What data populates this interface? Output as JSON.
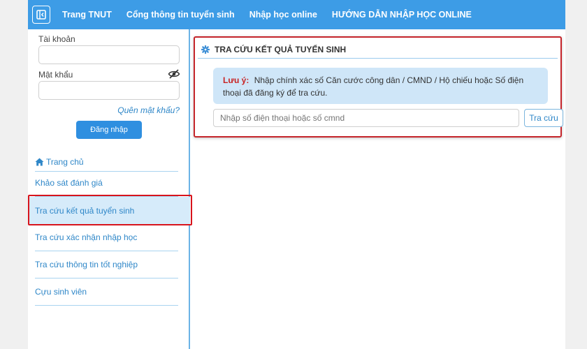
{
  "navbar": {
    "toggle_icon": "sidebar-collapse-icon",
    "links": [
      "Trang TNUT",
      "Cổng thông tin tuyển sinh",
      "Nhập học online",
      "HƯỚNG DẪN NHẬP HỌC ONLINE"
    ]
  },
  "login": {
    "account_label": "Tài khoản",
    "account_value": "",
    "password_label": "Mật khẩu",
    "password_value": "",
    "forgot_label": "Quên mật khẩu?",
    "login_button": "Đăng nhập"
  },
  "sidebar": {
    "home": "Trang chủ",
    "items": [
      "Khảo sát đánh giá",
      "Tra cứu kết quả tuyển sinh",
      "Tra cứu xác nhận nhập học",
      "Tra cứu thông tin tốt nghiệp",
      "Cựu sinh viên"
    ],
    "active_index": 1
  },
  "panel": {
    "title": "TRA CỨU KẾT QUẢ TUYỂN SINH",
    "notice_label": "Lưu ý:",
    "notice_text": "Nhập chính xác số Căn cước công dân / CMND / Hộ chiếu hoặc Số điện thoại đã đăng ký để tra cứu.",
    "input_placeholder": "Nhập số điện thoại hoặc số cmnd",
    "search_button": "Tra cứu"
  },
  "colors": {
    "navbar": "#3d9ce6",
    "link": "#2f87c8",
    "highlight": "#d8141c",
    "notice_bg": "#cfe6f8",
    "active_item_bg": "#d6ebfa"
  }
}
